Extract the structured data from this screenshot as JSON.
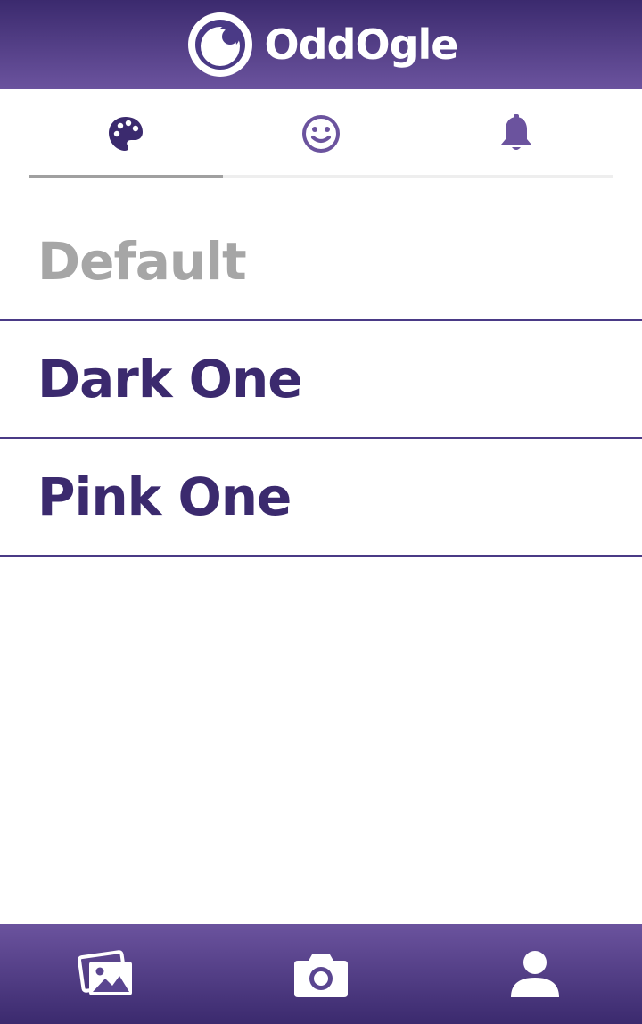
{
  "app": {
    "name": "OddOgle"
  },
  "colors": {
    "brand_dark": "#3b2a6e",
    "brand_light": "#6b539e",
    "text_primary": "#3b2a6e",
    "text_muted": "#a6a6a6",
    "divider": "#4a3a86"
  },
  "tabs": [
    {
      "icon": "palette-icon",
      "active": true
    },
    {
      "icon": "smiley-icon",
      "active": false
    },
    {
      "icon": "bell-icon",
      "active": false
    }
  ],
  "themes": [
    {
      "label": "Default",
      "selected": true
    },
    {
      "label": "Dark One",
      "selected": false
    },
    {
      "label": "Pink One",
      "selected": false
    }
  ],
  "bottom_nav": [
    {
      "icon": "gallery-icon"
    },
    {
      "icon": "camera-icon"
    },
    {
      "icon": "profile-icon"
    }
  ]
}
